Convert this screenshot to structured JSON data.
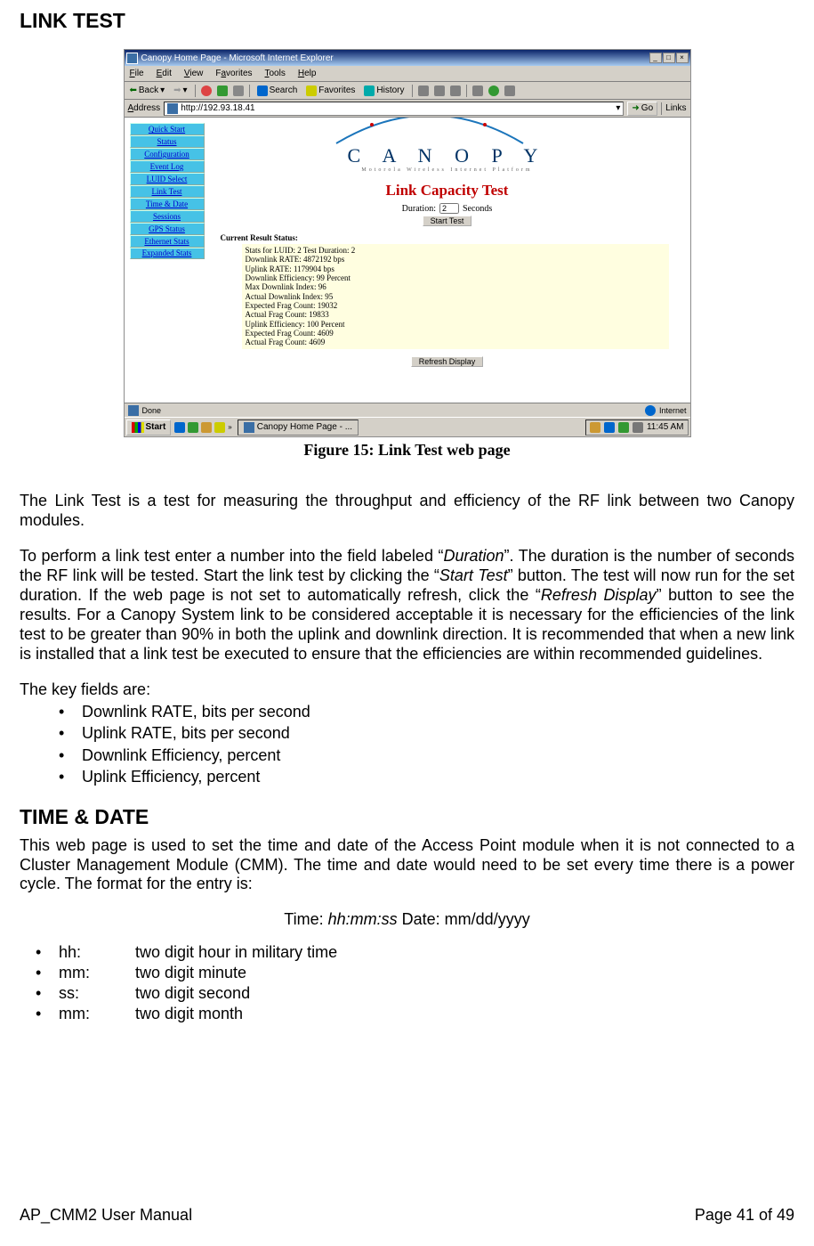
{
  "heading1": "LINK TEST",
  "screenshot": {
    "window_title": "Canopy Home Page - Microsoft Internet Explorer",
    "menu": [
      "File",
      "Edit",
      "View",
      "Favorites",
      "Tools",
      "Help"
    ],
    "toolbar": {
      "back": "Back",
      "search": "Search",
      "favorites": "Favorites",
      "history": "History"
    },
    "address_label": "Address",
    "address_url": "http://192.93.18.41",
    "go_label": "Go",
    "links_label": "Links",
    "logo_text": "C A N O P Y",
    "logo_sub": "Motorola Wireless Internet Platform",
    "page_title": "Link Capacity Test",
    "duration_label_left": "Duration:",
    "duration_value": "2",
    "duration_label_right": "Seconds",
    "start_button": "Start Test",
    "current_status_label": "Current Result Status:",
    "results": [
      "Stats for LUID: 2 Test Duration: 2",
      "Downlink RATE: 4872192 bps",
      "Uplink RATE: 1179904 bps",
      "Downlink Efficiency: 99 Percent",
      "Max Downlink Index: 96",
      "Actual Downlink Index: 95",
      "Expected Frag Count: 19032",
      "Actual Frag Count: 19833",
      "Uplink Efficiency: 100 Percent",
      "Expected Frag Count: 4609",
      "Actual Frag Count: 4609"
    ],
    "refresh_button": "Refresh Display",
    "status_done": "Done",
    "status_internet": "Internet",
    "nav": [
      "Quick Start",
      "Status",
      "Configuration",
      "Event Log",
      "LUID Select",
      "Link Test",
      "Time & Date",
      "Sessions",
      "GPS Status",
      "Ethernet Stats",
      "Expanded Stats"
    ],
    "start_label": "Start",
    "task_app": "Canopy Home Page - ...",
    "clock": "11:45 AM"
  },
  "caption": "Figure 15: Link Test web page",
  "para1_a": "The Link Test is a test for measuring the throughput and efficiency of the RF link between two Canopy modules.",
  "para2_a": "To perform a link test enter a number into the field labeled “",
  "para2_i1": "Duration",
  "para2_b": "”.  The duration is the number of seconds the RF link will be tested.  Start the link test by clicking the “",
  "para2_i2": "Start Test",
  "para2_c": "” button.  The test will now run for the set duration.  If the web page is not set to automatically refresh, click the “",
  "para2_i3": "Refresh Display",
  "para2_d": "” button to see the results.  For a Canopy System link to be considered acceptable it is necessary for the efficiencies of the link test to be greater than 90% in both the uplink and downlink direction.  It is recommended that when a new link is installed that a link test be executed to ensure that the efficiencies are within recommended guidelines.",
  "keyfields_label": "The key fields are:",
  "keyfields": [
    "Downlink RATE, bits per second",
    "Uplink RATE, bits per second",
    "Downlink Efficiency, percent",
    "Uplink Efficiency, percent"
  ],
  "heading2": "TIME & DATE",
  "para3": "This web page is used to set the time and date of the Access Point module when it is not connected to a Cluster Management Module (CMM).  The time and date would need to be set every time there is a power cycle.  The format for the entry is:",
  "format_pre": "Time: ",
  "format_italic": "hh:mm:ss",
  "format_post": "  Date: mm/dd/yyyy",
  "format_list": [
    {
      "k": "hh:",
      "v": "two digit hour in military time"
    },
    {
      "k": "mm:",
      "v": "two digit minute"
    },
    {
      "k": "ss:",
      "v": "two digit second"
    },
    {
      "k": "mm:",
      "v": "two digit month"
    }
  ],
  "footer_left": "AP_CMM2 User Manual",
  "footer_right": "Page 41 of 49"
}
